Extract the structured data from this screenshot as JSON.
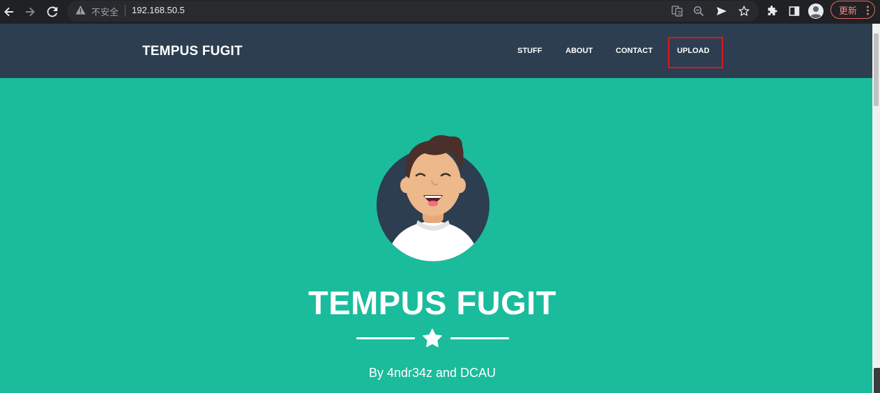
{
  "browser": {
    "insecure_label": "不安全",
    "url": "192.168.50.5",
    "update_label": "更新",
    "icons": [
      "back-icon",
      "forward-icon",
      "reload-icon",
      "warning-icon",
      "translate-icon",
      "zoom-icon",
      "send-icon",
      "bookmark-star-icon",
      "extensions-icon",
      "side-panel-icon",
      "profile-icon",
      "menu-dots-icon"
    ]
  },
  "navbar": {
    "brand": "TEMPUS FUGIT",
    "items": [
      {
        "label": "STUFF"
      },
      {
        "label": "ABOUT"
      },
      {
        "label": "CONTACT"
      },
      {
        "label": "UPLOAD",
        "highlighted": true
      }
    ],
    "background": "#2c3e50",
    "highlight_color": "#e0171d"
  },
  "hero": {
    "title": "TEMPUS FUGIT",
    "subtitle": "By 4ndr34z and DCAU",
    "background": "#1abc9c",
    "divider_icon": "star-icon",
    "avatar_icon": "avatar-icon"
  }
}
